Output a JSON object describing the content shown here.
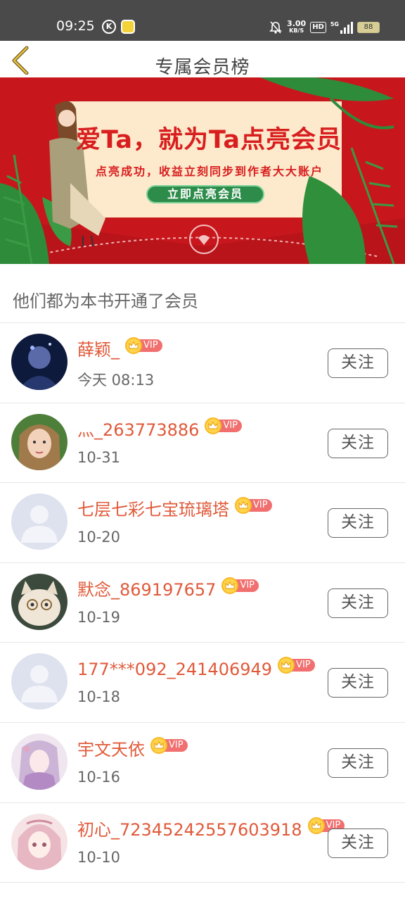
{
  "status_bar": {
    "time": "09:25",
    "speed_value": "3.00",
    "speed_unit": "KB/S",
    "hd": "HD",
    "network": "5G",
    "battery": "88"
  },
  "header": {
    "title": "专属会员榜"
  },
  "banner": {
    "title": "爱Ta，就为Ta点亮会员",
    "subtitle": "点亮成功，收益立刻同步到作者大大账户",
    "button_label": "立即点亮会员"
  },
  "section": {
    "title": "他们都为本书开通了会员"
  },
  "vip_label": "VIP",
  "follow_label": "关注",
  "members": [
    {
      "name": "薛颖_",
      "date": "今天 08:13",
      "avatar": "photo-dark-blue"
    },
    {
      "name": "灬_263773886",
      "date": "10-31",
      "avatar": "photo-girl"
    },
    {
      "name": "七层七彩七宝琉璃塔",
      "date": "10-20",
      "avatar": "default"
    },
    {
      "name": "默念_869197657",
      "date": "10-19",
      "avatar": "photo-cat"
    },
    {
      "name": "177***092_241406949",
      "date": "10-18",
      "avatar": "default"
    },
    {
      "name": "宇文天依",
      "date": "10-16",
      "avatar": "photo-anime"
    },
    {
      "name": "初心_72345242557603918",
      "date": "10-10",
      "avatar": "photo-anime-pink"
    }
  ],
  "colors": {
    "accent_name": "#e05a3a",
    "vip_pill": "#f16f6f",
    "vip_crown": "#ffd34a",
    "banner_bg": "#c8171c",
    "banner_button": "#2d8c4a"
  }
}
